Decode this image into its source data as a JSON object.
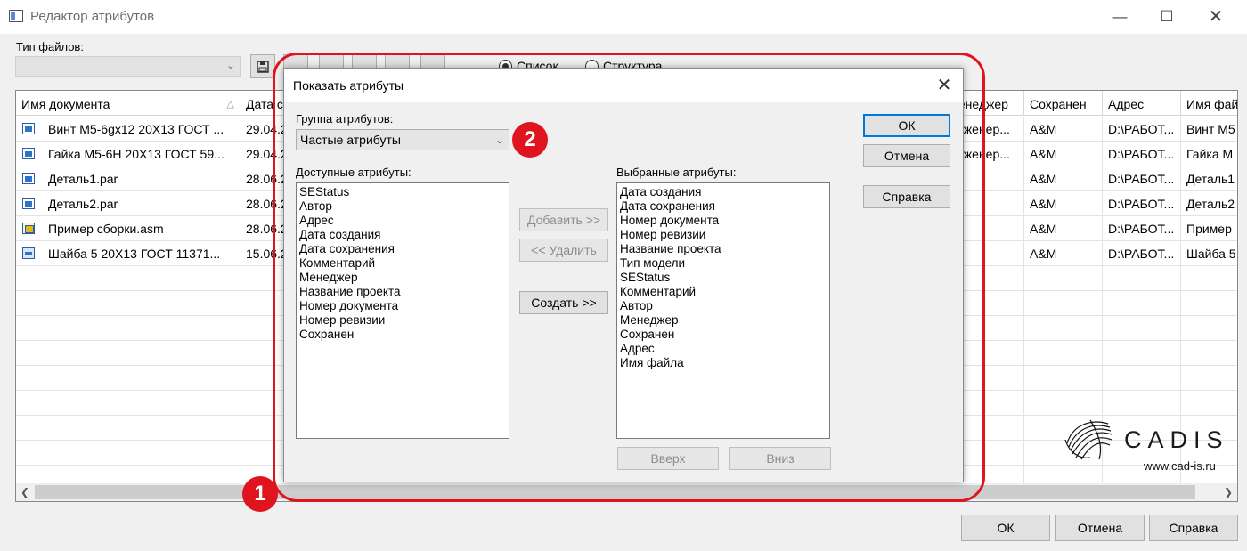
{
  "window": {
    "title": "Редактор атрибутов",
    "min_glyph": "—",
    "max_glyph": "☐",
    "close_glyph": "✕"
  },
  "toolbar": {
    "file_type_label": "Тип файлов:",
    "file_type_value": "",
    "view_list_label": "Список",
    "view_structure_label": "Структура"
  },
  "grid": {
    "columns": [
      "Имя документа",
      "Дата с",
      "Менеджер",
      "Сохранен",
      "Адрес",
      "Имя фай"
    ],
    "rows": [
      {
        "icon": "part",
        "name": "Винт М5-6gx12 20Х13 ГОСТ ...",
        "date": "29.04.2",
        "manager": "Инженер...",
        "saved": "A&M",
        "address": "D:\\РАБОТ...",
        "file": "Винт М5"
      },
      {
        "icon": "part",
        "name": "Гайка М5-6Н 20Х13 ГОСТ 59...",
        "date": "29.04.2",
        "manager": "Инженер...",
        "saved": "A&M",
        "address": "D:\\РАБОТ...",
        "file": "Гайка М"
      },
      {
        "icon": "part",
        "name": "Деталь1.par",
        "date": "28.06.2",
        "manager": "",
        "saved": "A&M",
        "address": "D:\\РАБОТ...",
        "file": "Деталь1"
      },
      {
        "icon": "part",
        "name": "Деталь2.par",
        "date": "28.06.2",
        "manager": "",
        "saved": "A&M",
        "address": "D:\\РАБОТ...",
        "file": "Деталь2"
      },
      {
        "icon": "asm",
        "name": "Пример сборки.asm",
        "date": "28.06.2",
        "manager": "",
        "saved": "A&M",
        "address": "D:\\РАБОТ...",
        "file": "Пример"
      },
      {
        "icon": "sheetmetal",
        "name": "Шайба 5 20Х13 ГОСТ 11371...",
        "date": "15.06.2",
        "manager": "",
        "saved": "A&M",
        "address": "D:\\РАБОТ...",
        "file": "Шайба 5"
      }
    ]
  },
  "buttons": {
    "ok": "ОК",
    "cancel": "Отмена",
    "help": "Справка"
  },
  "dialog": {
    "title": "Показать атрибуты",
    "close_glyph": "✕",
    "group_label": "Группа атрибутов:",
    "group_value": "Частые атрибуты",
    "available_label": "Доступные атрибуты:",
    "selected_label": "Выбранные атрибуты:",
    "available": [
      "SEStatus",
      "Автор",
      "Адрес",
      "Дата создания",
      "Дата сохранения",
      "Комментарий",
      "Менеджер",
      "Название проекта",
      "Номер документа",
      "Номер ревизии",
      "Сохранен"
    ],
    "selected": [
      "Дата создания",
      "Дата сохранения",
      "Номер документа",
      "Номер ревизии",
      "Название проекта",
      "Тип модели",
      "SEStatus",
      "Комментарий",
      "Автор",
      "Менеджер",
      "Сохранен",
      "Адрес",
      "Имя файла"
    ],
    "add": "Добавить >>",
    "remove": "<< Удалить",
    "create": "Создать >>",
    "up": "Вверх",
    "down": "Вниз",
    "ok": "ОК",
    "cancel": "Отмена",
    "help": "Справка"
  },
  "annotations": {
    "badge1": "1",
    "badge2": "2",
    "color": "#e0141e"
  },
  "watermark": {
    "brand": "CADIS",
    "url": "www.cad-is.ru"
  },
  "icons": {
    "part": "part-document-icon",
    "asm": "assembly-document-icon",
    "sheetmetal": "sheet-metal-document-icon"
  }
}
